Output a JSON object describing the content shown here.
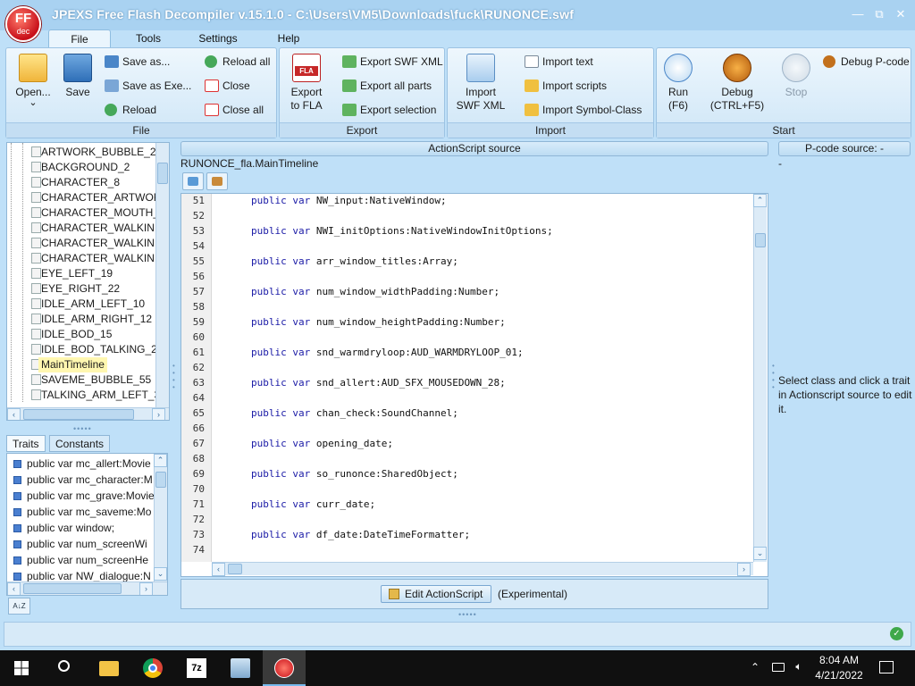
{
  "window": {
    "title": "JPEXS Free Flash Decompiler v.15.1.0 - C:\\Users\\VM5\\Downloads\\fuck\\RUNONCE.swf",
    "logo_top": "FF",
    "logo_bottom": "dec",
    "minimize": "—",
    "restore": "⧉",
    "close": "✕"
  },
  "ribbon_tabs": [
    "File",
    "Tools",
    "Settings",
    "Help"
  ],
  "ribbon": {
    "file_group": {
      "label": "File",
      "open": "Open...",
      "open_arrow": "⌄",
      "save": "Save",
      "save_as": "Save as...",
      "save_as_exe": "Save as Exe...",
      "reload": "Reload",
      "reload_all": "Reload all",
      "close": "Close",
      "close_all": "Close all"
    },
    "export_group": {
      "label": "Export",
      "export_to_fla_line1": "Export",
      "export_to_fla_line2": "to FLA",
      "fla_badge": "FLA",
      "export_swf_xml": "Export SWF XML",
      "export_all_parts": "Export all parts",
      "export_selection": "Export selection"
    },
    "import_group": {
      "label": "Import",
      "import_swf_xml_line1": "Import",
      "import_swf_xml_line2": "SWF XML",
      "import_text": "Import text",
      "import_scripts": "Import scripts",
      "import_symbol_class": "Import Symbol-Class"
    },
    "start_group": {
      "label": "Start",
      "run_line1": "Run",
      "run_line2": "(F6)",
      "debug_line1": "Debug",
      "debug_line2": "(CTRL+F5)",
      "stop": "Stop",
      "debug_pcode": "Debug P-code"
    }
  },
  "tree": {
    "items": [
      "ARTWORK_BUBBLE_2",
      "BACKGROUND_2",
      "CHARACTER_8",
      "CHARACTER_ARTWOR",
      "CHARACTER_MOUTH_",
      "CHARACTER_WALKIN",
      "CHARACTER_WALKIN",
      "CHARACTER_WALKIN",
      "EYE_LEFT_19",
      "EYE_RIGHT_22",
      "IDLE_ARM_LEFT_10",
      "IDLE_ARM_RIGHT_12",
      "IDLE_BOD_15",
      "IDLE_BOD_TALKING_2",
      "MainTimeline",
      "SAVEME_BUBBLE_55",
      "TALKING_ARM_LEFT_3"
    ],
    "selected_index": 14
  },
  "bottom_tabs": [
    "Traits",
    "Constants"
  ],
  "traits": [
    "public var mc_allert:Movie",
    "public var mc_character:M",
    "public var mc_grave:Movie",
    "public var mc_saveme:Mo",
    "public var window;",
    "public var num_screenWi",
    "public var num_screenHe",
    "public var NW_dialogue:N"
  ],
  "sort_button": "A↓Z",
  "actionscript": {
    "header": "ActionScript source",
    "class_path": "RUNONCE_fla.MainTimeline",
    "line_numbers": [
      "51",
      "52",
      "53",
      "54",
      "55",
      "56",
      "57",
      "58",
      "59",
      "60",
      "61",
      "62",
      "63",
      "64",
      "65",
      "66",
      "67",
      "68",
      "69",
      "70",
      "71",
      "72",
      "73",
      "74"
    ],
    "code_lines": [
      {
        "ln": "51",
        "text": "NW_input:NativeWindow;"
      },
      {
        "ln": "53",
        "text": "NWI_initOptions:NativeWindowInitOptions;"
      },
      {
        "ln": "55",
        "text": "arr_window_titles:Array;"
      },
      {
        "ln": "57",
        "text": "num_window_widthPadding:Number;"
      },
      {
        "ln": "59",
        "text": "num_window_heightPadding:Number;"
      },
      {
        "ln": "61",
        "text": "snd_warmdryloop:AUD_WARMDRYLOOP_01;"
      },
      {
        "ln": "63",
        "text": "snd_allert:AUD_SFX_MOUSEDOWN_28;"
      },
      {
        "ln": "65",
        "text": "chan_check:SoundChannel;"
      },
      {
        "ln": "67",
        "text": "opening_date;"
      },
      {
        "ln": "69",
        "text": "so_runonce:SharedObject;"
      },
      {
        "ln": "71",
        "text": "curr_date;"
      },
      {
        "ln": "73",
        "text": "df_date:DateTimeFormatter;"
      }
    ],
    "kw_public": "public",
    "kw_var": "var",
    "edit_button": "Edit ActionScript",
    "experimental": "(Experimental)"
  },
  "pcode": {
    "header": "P-code source: -",
    "dash": "-",
    "hint": "Select class and click a trait in Actionscript source to edit it."
  },
  "taskbar": {
    "time": "8:04 AM",
    "date": "4/21/2022",
    "app_7z": "7z"
  },
  "colors": {
    "ribbon_bg": "#cfe6f7",
    "title_bg": "#a9d2f1",
    "selected_bg": "#fff7b0",
    "keyword": "#1a1aa6"
  }
}
